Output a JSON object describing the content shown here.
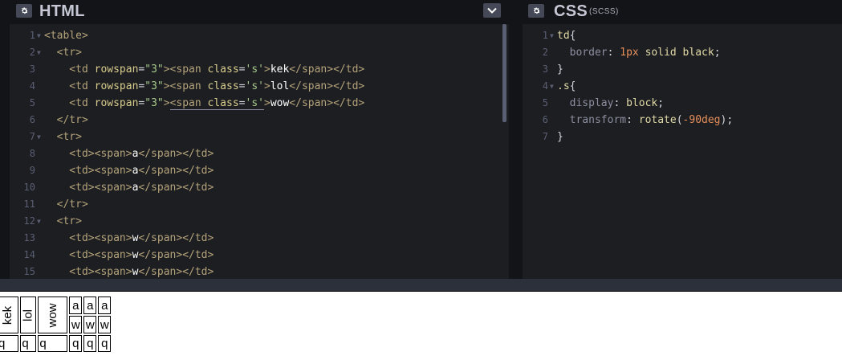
{
  "html_panel": {
    "title": "HTML",
    "lines": [
      [
        {
          "c": "tag",
          "t": "<table>"
        }
      ],
      [
        {
          "c": "tag",
          "t": "  <tr>"
        }
      ],
      [
        {
          "c": "tag",
          "t": "    <td "
        },
        {
          "c": "attr",
          "t": "rowspan"
        },
        {
          "c": "kw",
          "t": "="
        },
        {
          "c": "str",
          "t": "\"3\""
        },
        {
          "c": "tag",
          "t": "><span "
        },
        {
          "c": "attr",
          "t": "class"
        },
        {
          "c": "kw",
          "t": "="
        },
        {
          "c": "str",
          "t": "'s'"
        },
        {
          "c": "tag",
          "t": ">"
        },
        {
          "c": "txtw",
          "t": "kek"
        },
        {
          "c": "tag",
          "t": "</span></td>"
        }
      ],
      [
        {
          "c": "tag",
          "t": "    <td "
        },
        {
          "c": "attr",
          "t": "rowspan"
        },
        {
          "c": "kw",
          "t": "="
        },
        {
          "c": "str",
          "t": "\"3\""
        },
        {
          "c": "tag",
          "t": "><span "
        },
        {
          "c": "attr",
          "t": "class"
        },
        {
          "c": "kw",
          "t": "="
        },
        {
          "c": "str",
          "t": "'s'"
        },
        {
          "c": "tag",
          "t": ">"
        },
        {
          "c": "txtw",
          "t": "lol"
        },
        {
          "c": "tag",
          "t": "</span></td>"
        }
      ],
      [
        {
          "c": "tag",
          "t": "    <td "
        },
        {
          "c": "attr",
          "t": "rowspan"
        },
        {
          "c": "kw",
          "t": "="
        },
        {
          "c": "str",
          "t": "\"3\""
        },
        {
          "c": "tag",
          "t": ">"
        },
        {
          "c": "tag underline",
          "t": "<span "
        },
        {
          "c": "attr underline",
          "t": "class"
        },
        {
          "c": "kw underline",
          "t": "="
        },
        {
          "c": "str underline",
          "t": "'s'"
        },
        {
          "c": "tag",
          "t": ">"
        },
        {
          "c": "txtw",
          "t": "wow"
        },
        {
          "c": "tag",
          "t": "</span></td>"
        }
      ],
      [
        {
          "c": "tag",
          "t": "  </tr>"
        }
      ],
      [
        {
          "c": "tag",
          "t": "  <tr>"
        }
      ],
      [
        {
          "c": "tag",
          "t": "    <td><span>"
        },
        {
          "c": "txtw",
          "t": "a"
        },
        {
          "c": "tag",
          "t": "</span></td>"
        }
      ],
      [
        {
          "c": "tag",
          "t": "    <td><span>"
        },
        {
          "c": "txtw",
          "t": "a"
        },
        {
          "c": "tag",
          "t": "</span></td>"
        }
      ],
      [
        {
          "c": "tag",
          "t": "    <td><span>"
        },
        {
          "c": "txtw",
          "t": "a"
        },
        {
          "c": "tag",
          "t": "</span></td>"
        }
      ],
      [
        {
          "c": "tag",
          "t": "  </tr>"
        }
      ],
      [
        {
          "c": "tag",
          "t": "  <tr>"
        }
      ],
      [
        {
          "c": "tag",
          "t": "    <td><span>"
        },
        {
          "c": "txtw",
          "t": "w"
        },
        {
          "c": "tag",
          "t": "</span></td>"
        }
      ],
      [
        {
          "c": "tag",
          "t": "    <td><span>"
        },
        {
          "c": "txtw",
          "t": "w"
        },
        {
          "c": "tag",
          "t": "</span></td>"
        }
      ],
      [
        {
          "c": "tag",
          "t": "    <td><span>"
        },
        {
          "c": "txtw",
          "t": "w"
        },
        {
          "c": "tag",
          "t": "</span></td>"
        }
      ]
    ],
    "fold_lines": [
      1,
      2,
      7,
      12
    ]
  },
  "css_panel": {
    "title": "CSS",
    "subtitle": "(SCSS)",
    "lines": [
      [
        {
          "c": "sel",
          "t": "td"
        },
        {
          "c": "kw",
          "t": "{"
        }
      ],
      [
        {
          "c": "prop",
          "t": "  border"
        },
        {
          "c": "kw",
          "t": ": "
        },
        {
          "c": "num",
          "t": "1px"
        },
        {
          "c": "sel",
          "t": " solid black"
        },
        {
          "c": "kw",
          "t": ";"
        }
      ],
      [
        {
          "c": "kw",
          "t": "}"
        }
      ],
      [
        {
          "c": "sel",
          "t": ".s"
        },
        {
          "c": "kw",
          "t": "{"
        }
      ],
      [
        {
          "c": "prop",
          "t": "  display"
        },
        {
          "c": "kw",
          "t": ": "
        },
        {
          "c": "sel",
          "t": "block"
        },
        {
          "c": "kw",
          "t": ";"
        }
      ],
      [
        {
          "c": "prop",
          "t": "  transform"
        },
        {
          "c": "kw",
          "t": ": "
        },
        {
          "c": "sel",
          "t": "rotate"
        },
        {
          "c": "kw",
          "t": "("
        },
        {
          "c": "num",
          "t": "-90deg"
        },
        {
          "c": "kw",
          "t": ");"
        }
      ],
      [
        {
          "c": "kw",
          "t": "}"
        }
      ]
    ],
    "fold_lines": [
      1,
      4
    ]
  },
  "result": {
    "rotated": [
      "kek",
      "lol",
      "wow"
    ],
    "row1": [
      "a",
      "a",
      "a"
    ],
    "row2": [
      "w",
      "w",
      "w"
    ],
    "row3": [
      "q",
      "q",
      "q",
      "q",
      "q",
      "q"
    ]
  },
  "colors": {
    "editor_bg": "#1d1e22",
    "chrome_bg": "#131417",
    "button_bg": "#444857"
  },
  "icons": {
    "settings": "gear-icon",
    "dropdown": "chevron-down-icon"
  }
}
